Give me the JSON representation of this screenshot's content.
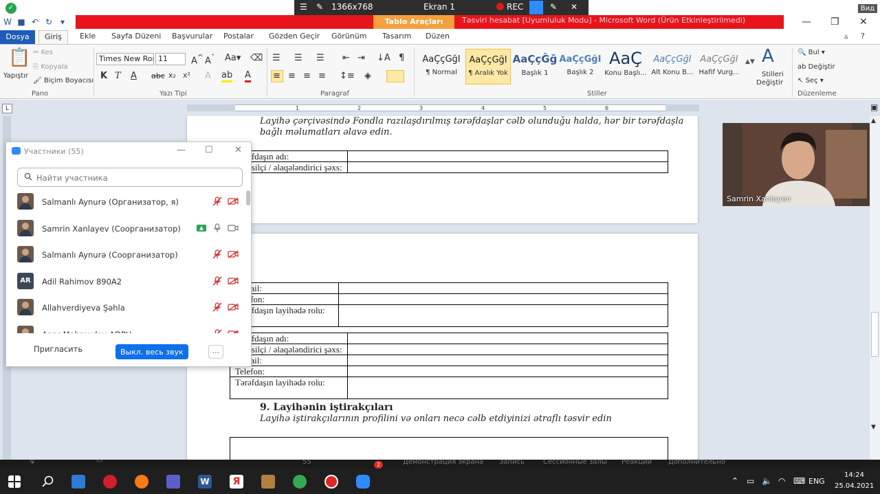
{
  "word": {
    "window_title": "Təsviri hesabat [Uyumluluk Modu] - Microsoft Word (Ürün Etkinleştirilmedi)",
    "context_tab": "Tablo Araçları",
    "tabs": [
      "Dosya",
      "Giriş",
      "Ekle",
      "Sayfa Düzeni",
      "Başvurular",
      "Postalar",
      "Gözden Geçir",
      "Görünüm",
      "Tasarım",
      "Düzen"
    ],
    "clipboard": {
      "paste": "Yapıştır",
      "cut": "Kes",
      "copy": "Kopyala",
      "format_painter": "Biçim Boyacısı",
      "group": "Pano"
    },
    "font": {
      "name": "Times New Roı",
      "size": "11",
      "group": "Yazı Tipi"
    },
    "paragraph_group": "Paragraf",
    "styles": [
      {
        "sample": "AaÇçĞğI",
        "name": "¶ Normal"
      },
      {
        "sample": "AaÇçĞğI",
        "name": "¶ Aralık Yok"
      },
      {
        "sample": "AaÇçĞğ",
        "name": "Başlık 1"
      },
      {
        "sample": "AaÇçĞğI",
        "name": "Başlık 2"
      },
      {
        "sample": "AaÇ",
        "name": "Konu Başlı..."
      },
      {
        "sample": "AaÇçĞğI",
        "name": "Alt Konu B..."
      },
      {
        "sample": "AaÇçĞğI",
        "name": "Hafif Vurg..."
      }
    ],
    "change_styles": [
      "Stilleri",
      "Değiştir"
    ],
    "styles_group": "Stiller",
    "editing": {
      "find": "Bul",
      "replace": "Değiştir",
      "select": "Seç",
      "group": "Düzenleme"
    },
    "ruler_numbers": [
      "1",
      "2",
      "3",
      "4",
      "5",
      "6"
    ]
  },
  "zoom_top": {
    "resolution": "1366x768",
    "screen": "Ekran 1",
    "rec": "REC",
    "corner": "Вид"
  },
  "document": {
    "page1_text_1": "Layihə çərçivəsində Fondla razılaşdırılmış tərəfdaşlar cəlb olunduğu halda, hər bir tərəfdaşla",
    "page1_text_2": "bağlı məlumatları əlavə edin.",
    "table1": [
      "Tərəfdaşın adı:",
      "Təmsilçi / əlaqələndirici şəxs:"
    ],
    "table2": [
      "E-mail:",
      "Telefon:",
      "Tərəfdaşın layihədə rolu:"
    ],
    "table3": [
      "Tərəfdaşın adı:",
      "Təmsilçi / əlaqələndirici şəxs:",
      "E-mail:",
      "Telefon:",
      "Tərəfdaşın layihədə rolu:"
    ],
    "section_heading": "9. Layihənin iştirakçıları",
    "section_text": "Layihə iştirakçılarının profilini və onları necə cəlb etdiyinizi ətraflı təsvir edin"
  },
  "participants": {
    "title": "Участники (55)",
    "search_placeholder": "Найти участника",
    "list": [
      {
        "name": "Salmanlı Aynurə (Организатор, я)",
        "avatar": "photo",
        "muted": true,
        "video_off": true,
        "sharing": false
      },
      {
        "name": "Samrin Xanlayev (Соорганизатор)",
        "avatar": "photo",
        "muted": false,
        "video_off": false,
        "sharing": true
      },
      {
        "name": "Salmanlı Aynurə (Соорганизатор)",
        "avatar": "photo",
        "muted": true,
        "video_off": true,
        "sharing": false
      },
      {
        "name": "Adil Rahimov 890A2",
        "avatar": "AR",
        "muted": true,
        "video_off": true,
        "sharing": false
      },
      {
        "name": "Allahverdiyeva Şəhla",
        "avatar": "photo",
        "muted": true,
        "video_off": true,
        "sharing": false
      },
      {
        "name": "Anar Mahmudov ADPU",
        "avatar": "photo",
        "muted": true,
        "video_off": true,
        "sharing": false
      }
    ],
    "invite": "Пригласить",
    "mute_all": "Выкл. весь звук",
    "more": "..."
  },
  "video": {
    "name": "Samrin Xanlayev"
  },
  "zoom_bottom": {
    "participants_count": "55",
    "chat_badge": "2",
    "share_label": "Демонстрация экрана",
    "record_label": "Запись",
    "rooms_label": "Сессионные залы",
    "reactions_label": "Реакции",
    "more_label": "Дополнительно"
  },
  "taskbar": {
    "lang": "ENG",
    "time": "14:24",
    "date": "25.04.2021"
  },
  "colors": {
    "word_blue": "#1f5bb8",
    "title_red": "#e8141b",
    "tablo_orange": "#f6a03d",
    "zoom_blue": "#0e71eb",
    "share_green": "#23a55a"
  }
}
